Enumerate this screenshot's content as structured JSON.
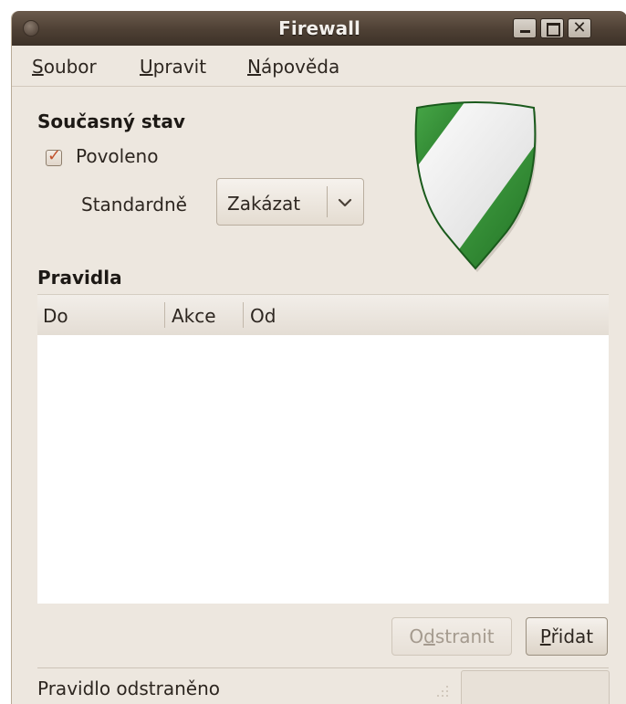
{
  "window": {
    "title": "Firewall"
  },
  "menu": {
    "items": [
      {
        "accel": "S",
        "rest": "oubor"
      },
      {
        "accel": "U",
        "rest": "pravit"
      },
      {
        "accel": "N",
        "rest": "ápověda"
      }
    ]
  },
  "state": {
    "heading": "Současný stav",
    "enabled_label": "Povoleno",
    "enabled_checked": true,
    "default_label": "Standardně",
    "default_value": "Zakázat"
  },
  "rules": {
    "heading": "Pravidla",
    "columns": [
      "Do",
      "Akce",
      "Od"
    ],
    "rows": []
  },
  "buttons": {
    "remove": {
      "pre": "O",
      "accel": "d",
      "post": "stranit",
      "enabled": false
    },
    "add": {
      "pre": "",
      "accel": "P",
      "post": "řidat",
      "enabled": true
    }
  },
  "status": {
    "text": "Pravidlo odstraněno"
  },
  "icons": {
    "shield": "shield-icon",
    "checkbox": "checkmark-icon",
    "dropdown": "chevron-down-icon"
  },
  "colors": {
    "shield_green": "#2f8f2f",
    "titlebar": "#4e4034",
    "window_bg": "#ede7df",
    "check_mark": "#c2522d"
  }
}
